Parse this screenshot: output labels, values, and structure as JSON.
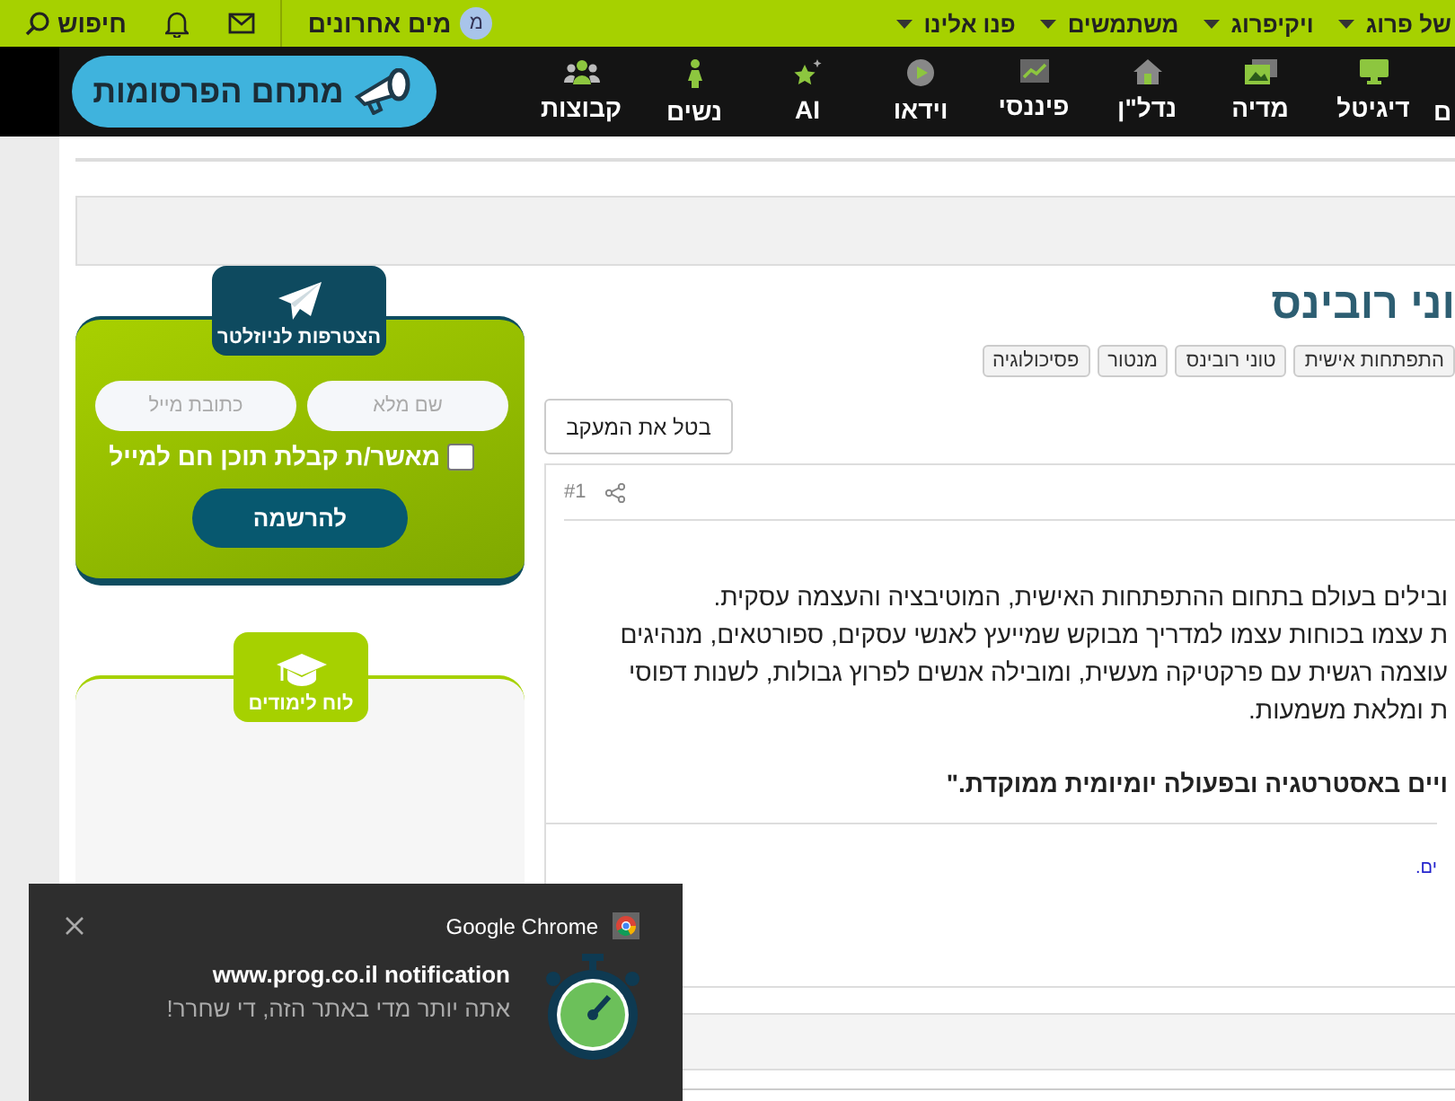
{
  "top_bar": {
    "menus": [
      {
        "label": "של פרוג"
      },
      {
        "label": "ויקיפרוג"
      },
      {
        "label": "משתמשים"
      },
      {
        "label": "פנו אלינו"
      }
    ],
    "user": {
      "initial": "מ",
      "name": "מים אחרונים"
    },
    "search_label": "חיפוש"
  },
  "nav": {
    "items": [
      {
        "label": "ם"
      },
      {
        "label": "דיגיטל"
      },
      {
        "label": "מדיה"
      },
      {
        "label": "נדל\"ן"
      },
      {
        "label": "פיננסי"
      },
      {
        "label": "וידאו"
      },
      {
        "label": "AI"
      },
      {
        "label": "נשים"
      },
      {
        "label": "קבוצות"
      }
    ],
    "promo_button": "מתחם הפרסומות"
  },
  "thread": {
    "title": "וני רובינס",
    "tags": [
      "התפתחות אישית",
      "טוני רובינס",
      "מנטור",
      "פסיכולוגיה"
    ],
    "unfollow_button": "בטל את המעקב",
    "post": {
      "number": "#1",
      "lines": [
        "ובילים בעולם בתחום ההתפתחות האישית, המוטיבציה והעצמה עסקית.",
        "ת עצמו בכוחות עצמו למדריך מבוקש שמייעץ לאנשי עסקים, ספורטאים, מנהיגים",
        "עוצמה רגשית עם פרקטיקה מעשית, ומובילה אנשים לפרוץ גבולות, לשנות דפוסי",
        "ת ומלאת משמעות."
      ],
      "bold_line": "ויים באסטרטגיה ובפעולה יומיומית ממוקדת.\"",
      "link": "ים."
    }
  },
  "newsletter": {
    "title": "הצטרפות לניוזלטר",
    "name_placeholder": "שם מלא",
    "email_placeholder": "כתובת מייל",
    "consent": {
      "label": "מאשר/ת קבלת תוכן חם למייל",
      "checked": false
    },
    "submit": "להרשמה"
  },
  "study_board": {
    "title": "לוח לימודים"
  },
  "notification": {
    "app": "Google Chrome",
    "title": "www.prog.co.il notification",
    "body": "אתה יותר מדי באתר הזה, די שחרר!"
  }
}
